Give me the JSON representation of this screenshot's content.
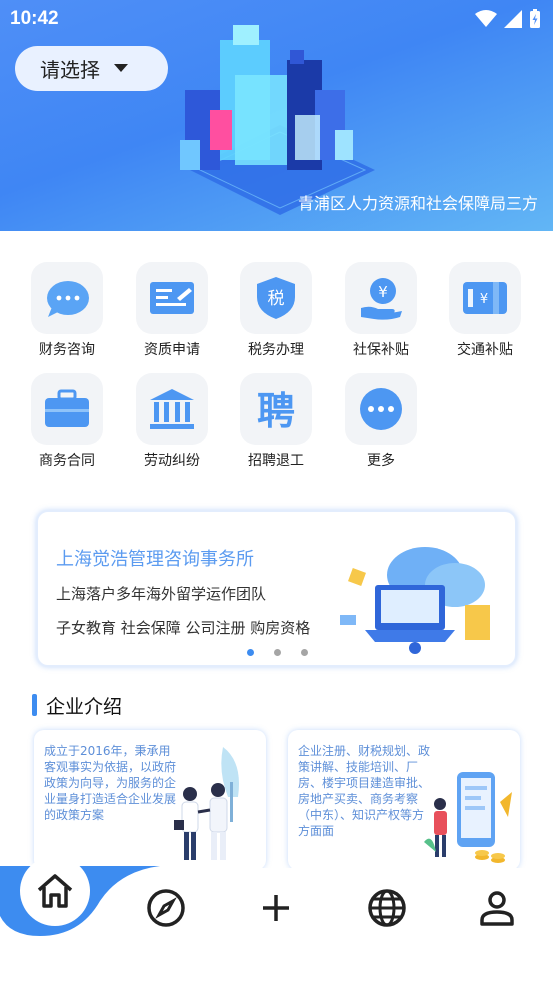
{
  "status_bar": {
    "time": "10:42"
  },
  "header": {
    "selector_label": "请选择",
    "caption": "青浦区人力资源和社会保障局三方"
  },
  "services": [
    {
      "label": "财务咨询",
      "icon": "chat-bubbles-icon"
    },
    {
      "label": "资质申请",
      "icon": "certificate-card-icon"
    },
    {
      "label": "税务办理",
      "icon": "tax-shield-icon"
    },
    {
      "label": "社保补贴",
      "icon": "yuan-hand-icon"
    },
    {
      "label": "交通补贴",
      "icon": "yuan-card-icon"
    },
    {
      "label": "商务合同",
      "icon": "briefcase-icon"
    },
    {
      "label": "劳动纠纷",
      "icon": "courthouse-icon"
    },
    {
      "label": "招聘退工",
      "icon": "recruit-character-icon"
    },
    {
      "label": "更多",
      "icon": "more-dots-icon"
    }
  ],
  "banner": {
    "title": "上海觉浩管理咨询事务所",
    "line1": "上海落户多年海外留学运作团队",
    "line2": "子女教育 社会保障 公司注册 购房资格",
    "page_count": 3,
    "active_page": 1
  },
  "section": {
    "title": "企业介绍"
  },
  "cards": [
    {
      "text": "成立于2016年，秉承用客观事实为依据，以政府政策为向导，为服务的企业量身打造适合企业发展的政策方案"
    },
    {
      "text": "企业注册、财税规划、政策讲解、技能培训、厂房、楼宇项目建造审批、房地产买卖、商务考察（中东）、知识产权等方方面面"
    }
  ],
  "tabbar": {
    "items": [
      "home-icon",
      "compass-icon",
      "plus-icon",
      "globe-icon",
      "person-icon"
    ],
    "active": "home-icon"
  },
  "colors": {
    "accent": "#3d8cf0",
    "hero_start": "#4f8ff7",
    "hero_end": "#62b6f5",
    "icon_bg": "#f2f4f7"
  }
}
